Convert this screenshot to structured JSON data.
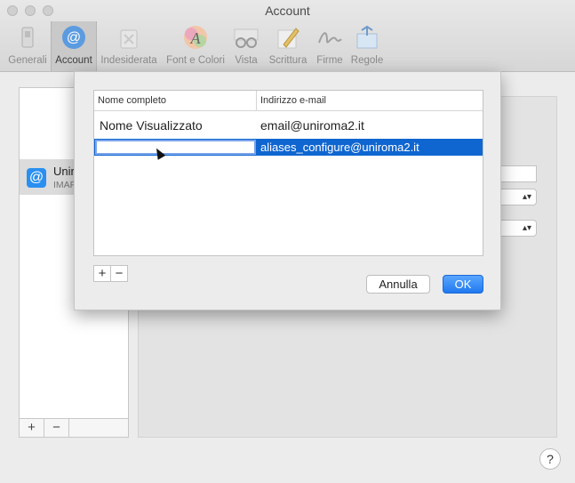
{
  "window": {
    "title": "Account"
  },
  "toolbar": {
    "items": [
      {
        "label": "Generali",
        "icon": "switch-icon"
      },
      {
        "label": "Account",
        "icon": "at-icon"
      },
      {
        "label": "Indesiderata",
        "icon": "junk-icon"
      },
      {
        "label": "Font e Colori",
        "icon": "font-color-icon"
      },
      {
        "label": "Vista",
        "icon": "glasses-icon"
      },
      {
        "label": "Scrittura",
        "icon": "pencil-icon"
      },
      {
        "label": "Firme",
        "icon": "signature-icon"
      },
      {
        "label": "Regole",
        "icon": "rules-icon"
      }
    ]
  },
  "accounts": {
    "name": "Unir",
    "type": "IMAP",
    "add_label": "+",
    "remove_label": "−"
  },
  "sheet": {
    "columns": [
      "Nome completo",
      "Indirizzo e-mail"
    ],
    "rows": [
      {
        "name": "Nome Visualizzato",
        "email": "email@uniroma2.it"
      },
      {
        "name": "",
        "email": "aliases_configure@uniroma2.it"
      }
    ],
    "add_label": "+",
    "remove_label": "−",
    "cancel_label": "Annulla",
    "ok_label": "OK"
  },
  "help": {
    "label": "?"
  }
}
